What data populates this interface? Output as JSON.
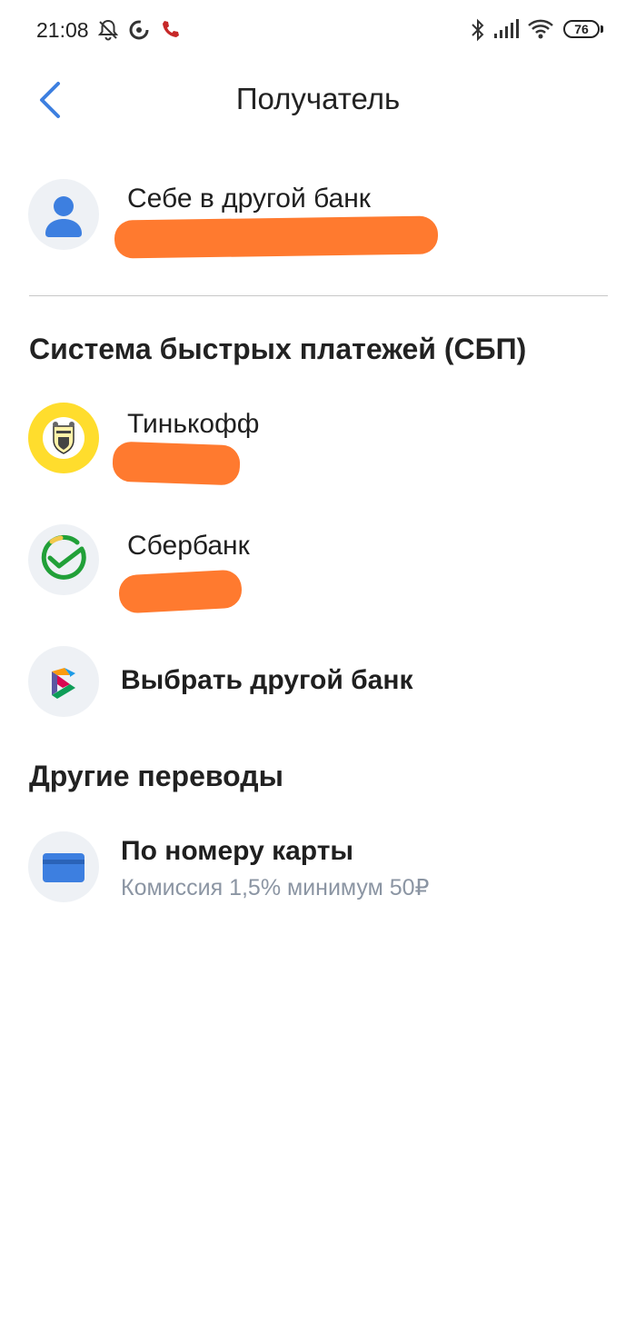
{
  "status_bar": {
    "time": "21:08",
    "battery": "76",
    "icons": [
      "muted-bell-icon",
      "sync-icon",
      "call-icon",
      "bluetooth-icon",
      "signal-icon",
      "wifi-icon",
      "battery-icon"
    ]
  },
  "header": {
    "title": "Получатель",
    "back_icon": "chevron-left-icon"
  },
  "self_transfer": {
    "label": "Себе в другой банк",
    "icon": "person-icon"
  },
  "sbp_section": {
    "title": "Система быстрых платежей (СБП)",
    "items": [
      {
        "label": "Тинькофф",
        "icon": "tinkoff-logo-icon"
      },
      {
        "label": "Сбербанк",
        "icon": "sberbank-logo-icon"
      },
      {
        "label": "Выбрать другой банк",
        "icon": "sbp-logo-icon"
      }
    ]
  },
  "other_section": {
    "title": "Другие переводы",
    "items": [
      {
        "label": "По номеру карты",
        "subtitle": "Комиссия 1,5% минимум 50₽",
        "icon": "card-icon"
      }
    ]
  },
  "colors": {
    "accent": "#3d7fe0",
    "redaction": "#ff7a2f",
    "avatar_bg": "#eef1f5",
    "subtext": "#8b95a3",
    "tinkoff_yellow": "#ffdd2d",
    "sber_green": "#21a038"
  }
}
